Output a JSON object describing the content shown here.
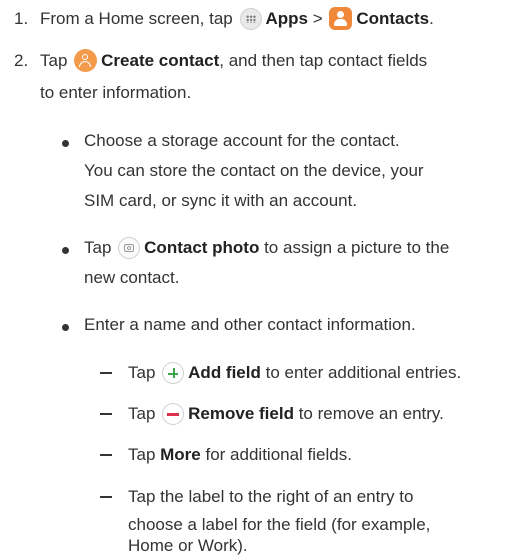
{
  "steps": [
    {
      "number": "1.",
      "text_before": "From a Home screen, tap",
      "apps_label": "Apps",
      "separator": ">",
      "contacts_label": "Contacts",
      "end_punct": "."
    },
    {
      "number": "2.",
      "text_before": "Tap",
      "create_label": "Create contact",
      "line1_after": ", and then tap contact fields",
      "line2": "to enter information."
    }
  ],
  "bullets": [
    {
      "lines": [
        "Choose a storage account for the contact.",
        "You can store the contact on the device, your",
        "SIM card, or sync it with an account."
      ]
    },
    {
      "text_before": "Tap",
      "bold_label": "Contact photo",
      "line1_after": " to assign a picture to the",
      "line2": "new contact."
    },
    {
      "lines": [
        "Enter a name and other contact information."
      ]
    }
  ],
  "sub_bullets": [
    {
      "text_before": "Tap",
      "bold_label": "Add field",
      "after": " to enter additional entries."
    },
    {
      "text_before": "Tap",
      "bold_label": "Remove field",
      "after": " to remove an entry."
    },
    {
      "text_before": "Tap ",
      "bold_label": "More",
      "after": " for additional fields."
    },
    {
      "lines": [
        "Tap the label to the right of an entry to",
        "choose a label for the field (for example,",
        "Home or Work)."
      ]
    }
  ],
  "icons": {
    "apps": "apps-grid-icon",
    "contacts": "contacts-app-icon",
    "create_contact": "create-contact-icon",
    "contact_photo": "camera-icon",
    "add_field": "plus-icon",
    "remove_field": "minus-icon"
  },
  "colors": {
    "contacts_icon": "#f0883a",
    "create_icon": "#f39a4b",
    "add_green": "#3fa34d",
    "remove_red": "#e0314b"
  }
}
